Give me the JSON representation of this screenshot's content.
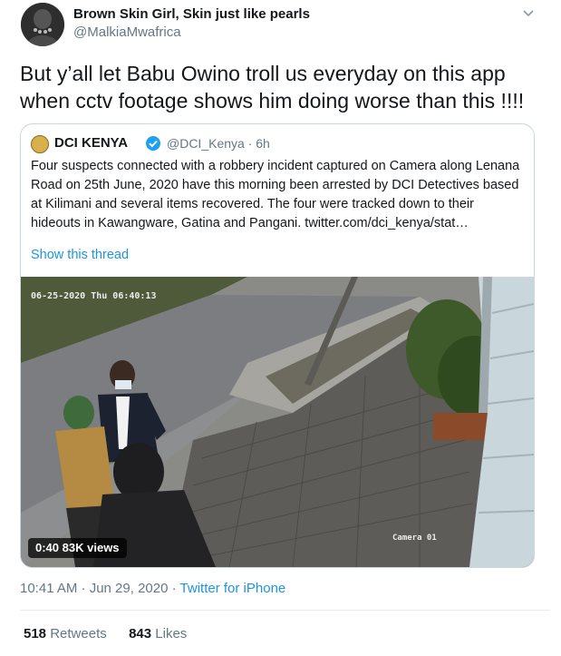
{
  "tweet": {
    "author_name": "Brown Skin Girl, Skin just like pearls",
    "author_handle": "@MalkiaMwafrica",
    "text": "But y’all let Babu Owino troll us everyday on this app when cctv footage shows him doing worse than this !!!!",
    "timestamp": "10:41 AM · Jun 29, 2020",
    "source": "Twitter for iPhone",
    "retweets_count": "518",
    "retweets_label": "Retweets",
    "likes_count": "843",
    "likes_label": "Likes"
  },
  "quote": {
    "author_name": "DCI KENYA",
    "author_handle": "@DCI_Kenya · 6h",
    "text": "Four suspects connected with a robbery incident captured on Camera along Lenana Road on 25th June, 2020 have this morning been arrested by DCI Detectives based at Kilimani and several items recovered. The four were tracked down to their hideouts in Kawangware, Gatina and Pangani. twitter.com/dci_kenya/stat…",
    "show_thread": "Show this thread",
    "video": {
      "cam_timestamp": "06-25-2020 Thu 06:40:13",
      "cam_label": "Camera 01",
      "duration": "0:40",
      "views": "83K views"
    }
  },
  "colors": {
    "link": "#1b95e0",
    "verified": "#1da1f2",
    "muted": "#657786"
  }
}
